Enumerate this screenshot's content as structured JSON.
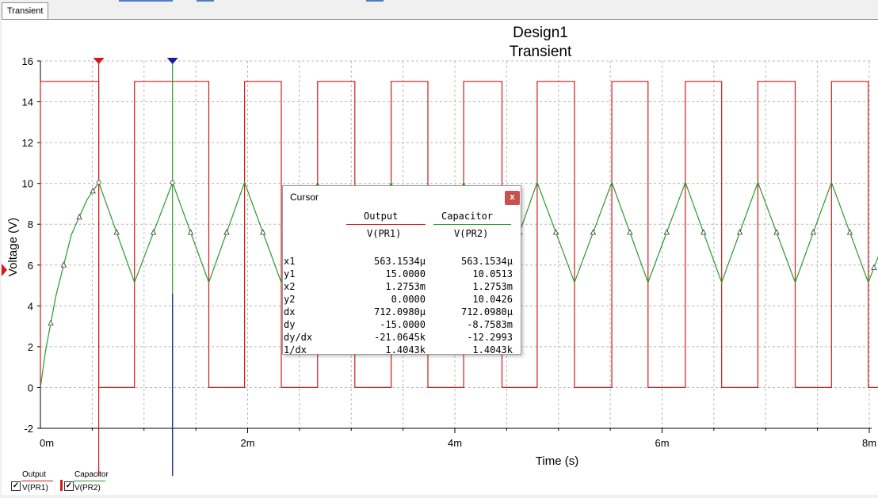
{
  "tabs": [
    {
      "label": "Transient"
    }
  ],
  "colors": {
    "output": "#d11a1a",
    "capacitor": "#2a9a2a",
    "cursor1": "#d11a1a",
    "cursor2": "#1a1aa0",
    "grid": "#b8b8b8"
  },
  "chart_data": {
    "type": "line",
    "title": "Design1",
    "subtitle": "Transient",
    "xlabel": "Time (s)",
    "ylabel": "Voltage (V)",
    "xlim": [
      0,
      0.008
    ],
    "ylim": [
      -2,
      16
    ],
    "grid": true,
    "x_ticks": [
      {
        "v": 0,
        "label": "0m"
      },
      {
        "v": 0.002,
        "label": "2m"
      },
      {
        "v": 0.004,
        "label": "4m"
      },
      {
        "v": 0.006,
        "label": "6m"
      },
      {
        "v": 0.008,
        "label": "8m"
      }
    ],
    "y_ticks": [
      {
        "v": -2,
        "label": "-2"
      },
      {
        "v": 0,
        "label": "0"
      },
      {
        "v": 2,
        "label": "2"
      },
      {
        "v": 4,
        "label": "4"
      },
      {
        "v": 6,
        "label": "6"
      },
      {
        "v": 8,
        "label": "8"
      },
      {
        "v": 10,
        "label": "10"
      },
      {
        "v": 12,
        "label": "12"
      },
      {
        "v": 14,
        "label": "14"
      },
      {
        "v": 16,
        "label": "16"
      }
    ],
    "series": [
      {
        "name": "Output",
        "probe": "V(PR1)",
        "color": "#d11a1a",
        "x": [
          0,
          0,
          0.000563,
          0.000563,
          0.000908,
          0.000908,
          0.001625,
          0.001625,
          0.00197,
          0.00197,
          0.002325,
          0.002325,
          0.002675,
          0.002675,
          0.003035,
          0.003035,
          0.003385,
          0.003385,
          0.00374,
          0.00374,
          0.004085,
          0.004085,
          0.004455,
          0.004455,
          0.004795,
          0.004795,
          0.005155,
          0.005155,
          0.005515,
          0.005515,
          0.005865,
          0.005865,
          0.006225,
          0.006225,
          0.006575,
          0.006575,
          0.006925,
          0.006925,
          0.007285,
          0.007285,
          0.007635,
          0.007635,
          0.00799,
          0.00799,
          0.0081
        ],
        "y": [
          0,
          15,
          15,
          0,
          0,
          15,
          15,
          0,
          0,
          15,
          15,
          0,
          0,
          15,
          15,
          0,
          0,
          15,
          15,
          0,
          0,
          15,
          15,
          0,
          0,
          15,
          15,
          0,
          0,
          15,
          15,
          0,
          0,
          15,
          15,
          0,
          0,
          15,
          15,
          0,
          0,
          15,
          15,
          0,
          0
        ]
      },
      {
        "name": "Capacitor",
        "probe": "V(PR2)",
        "color": "#2a9a2a",
        "x": [
          0,
          5e-05,
          0.00015,
          0.0003,
          0.00045,
          0.000563,
          0.000908,
          0.001275,
          0.001625,
          0.00197,
          0.002325,
          0.002675,
          0.003035,
          0.003385,
          0.00374,
          0.004085,
          0.004455,
          0.004795,
          0.005155,
          0.005515,
          0.005865,
          0.006225,
          0.006575,
          0.006925,
          0.007285,
          0.007635,
          0.00799,
          0.0081
        ],
        "y": [
          0,
          1.8,
          4.5,
          7.5,
          9.2,
          10.05,
          5.15,
          10.04,
          5.15,
          10.05,
          5.15,
          10.05,
          5.15,
          10.05,
          5.15,
          10.05,
          5.15,
          10.05,
          5.15,
          10.05,
          5.15,
          10.05,
          5.15,
          10.05,
          5.15,
          10.05,
          5.15,
          6.6
        ]
      }
    ],
    "cursors": [
      {
        "name": "x1",
        "x": 0.000563,
        "color": "#d11a1a"
      },
      {
        "name": "x2",
        "x": 0.001275,
        "color": "#1a1aa0"
      }
    ]
  },
  "cursor_popup": {
    "title": "Cursor",
    "close_label": "x",
    "columns": [
      {
        "name": "Output",
        "probe": "V(PR1)"
      },
      {
        "name": "Capacitor",
        "probe": "V(PR2)"
      }
    ],
    "rows": [
      {
        "label": "x1",
        "output": "563.1534µ",
        "capacitor": "563.1534µ"
      },
      {
        "label": "y1",
        "output": "15.0000",
        "capacitor": "10.0513"
      },
      {
        "label": "x2",
        "output": "1.2753m",
        "capacitor": "1.2753m"
      },
      {
        "label": "y2",
        "output": "0.0000",
        "capacitor": "10.0426"
      },
      {
        "label": "dx",
        "output": "712.0980µ",
        "capacitor": "712.0980µ"
      },
      {
        "label": "dy",
        "output": "-15.0000",
        "capacitor": "-8.7583m"
      },
      {
        "label": "dy/dx",
        "output": "-21.0645k",
        "capacitor": "-12.2993"
      },
      {
        "label": "1/dx",
        "output": "1.4043k",
        "capacitor": "1.4043k"
      }
    ]
  },
  "legend": [
    {
      "name": "Output",
      "probe": "V(PR1)",
      "checked": true,
      "check": "✓"
    },
    {
      "name": "Capacitor",
      "probe": "V(PR2)",
      "checked": true,
      "check": "✓"
    }
  ]
}
